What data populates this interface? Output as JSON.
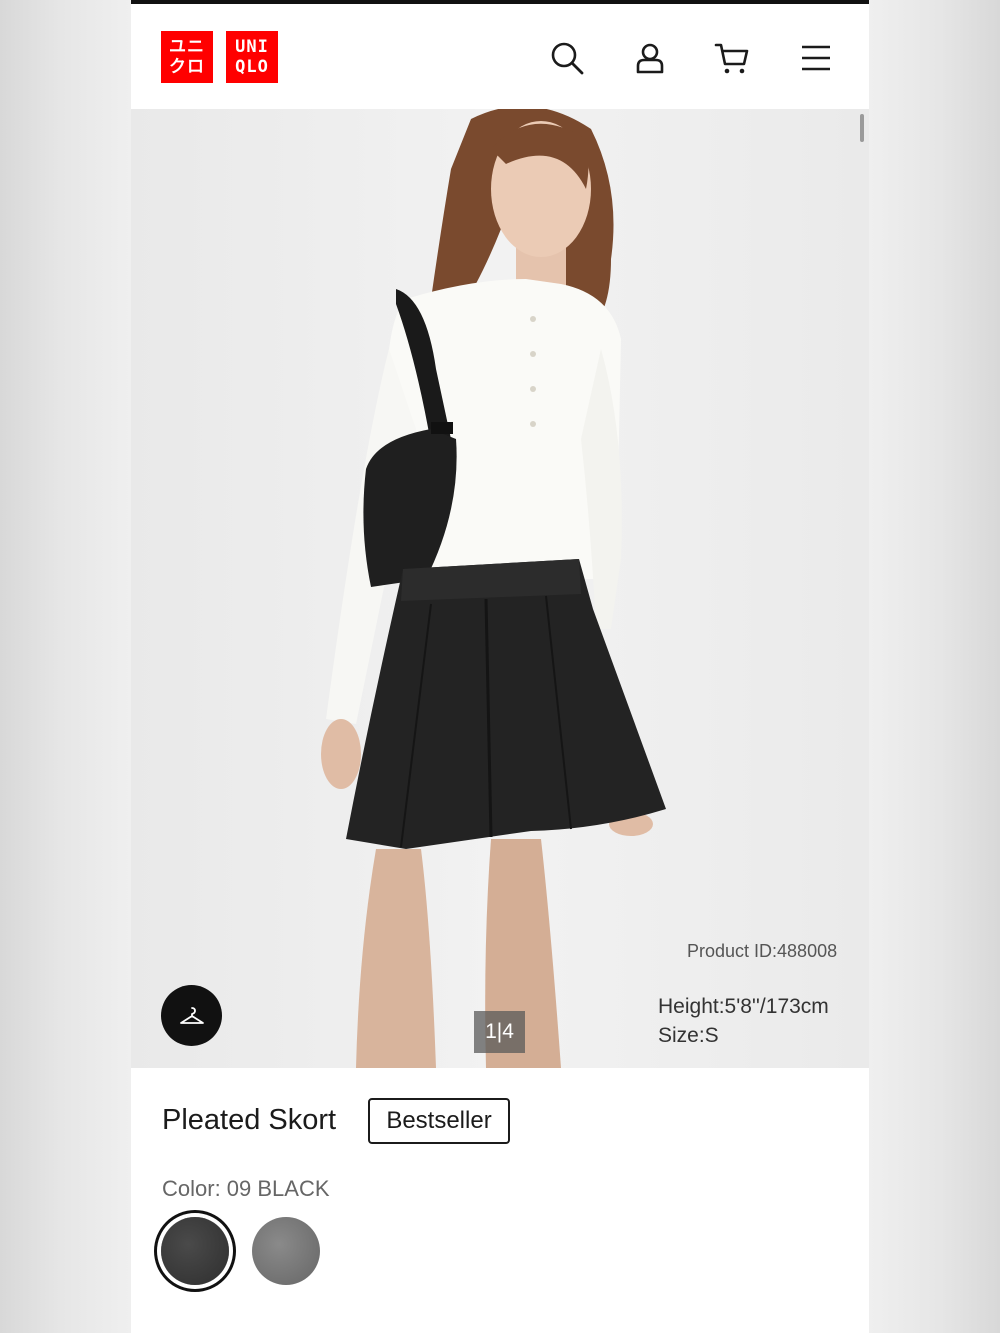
{
  "header": {
    "logo": {
      "line1": "ユニ",
      "line2": "クロ",
      "line3": "UNI",
      "line4": "QLO",
      "brand_color": "#ff0000"
    },
    "icons": [
      "search-icon",
      "account-icon",
      "cart-icon",
      "menu-icon"
    ]
  },
  "gallery": {
    "product_id": "Product ID:488008",
    "model_height": "Height:5'8''/173cm",
    "model_size": "Size:S",
    "pager": "1|4"
  },
  "product": {
    "name": "Pleated Skort",
    "badge": "Bestseller",
    "color_label": "Color: 09 BLACK",
    "swatches": [
      {
        "name": "black",
        "hex": "#3a3a3a",
        "selected": true
      },
      {
        "name": "gray",
        "hex": "#777777",
        "selected": false
      }
    ]
  }
}
